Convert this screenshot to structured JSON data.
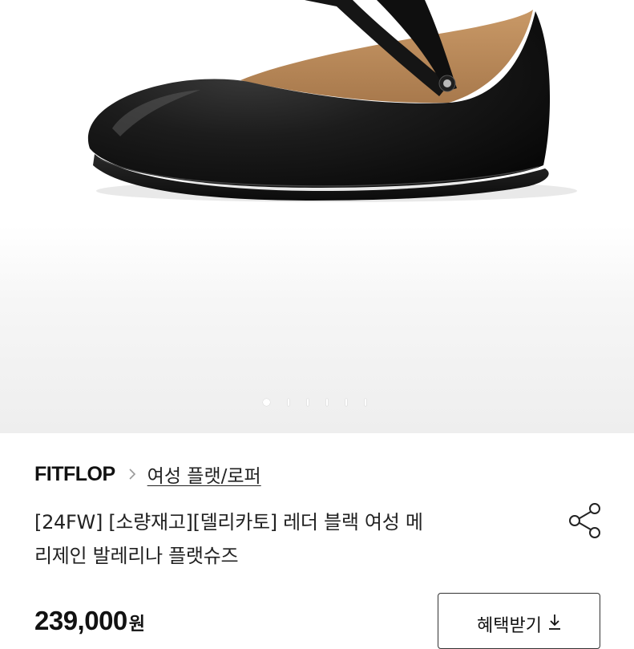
{
  "hero": {
    "image_alt": "black leather mary jane ballerina flat shoe",
    "pagination": {
      "current": 1,
      "total": 6
    }
  },
  "product": {
    "brand": "FITFLOP",
    "category": "여성 플랫/로퍼",
    "title_line1": "[24FW] [소량재고][델리카토] 레더 블랙 여성 메",
    "title_line2": "리제인 발레리나 플랫슈즈",
    "price": "239,000",
    "currency": "원"
  },
  "actions": {
    "benefit_label": "혜택받기",
    "share_icon": "share-icon",
    "download_icon": "download-icon"
  }
}
